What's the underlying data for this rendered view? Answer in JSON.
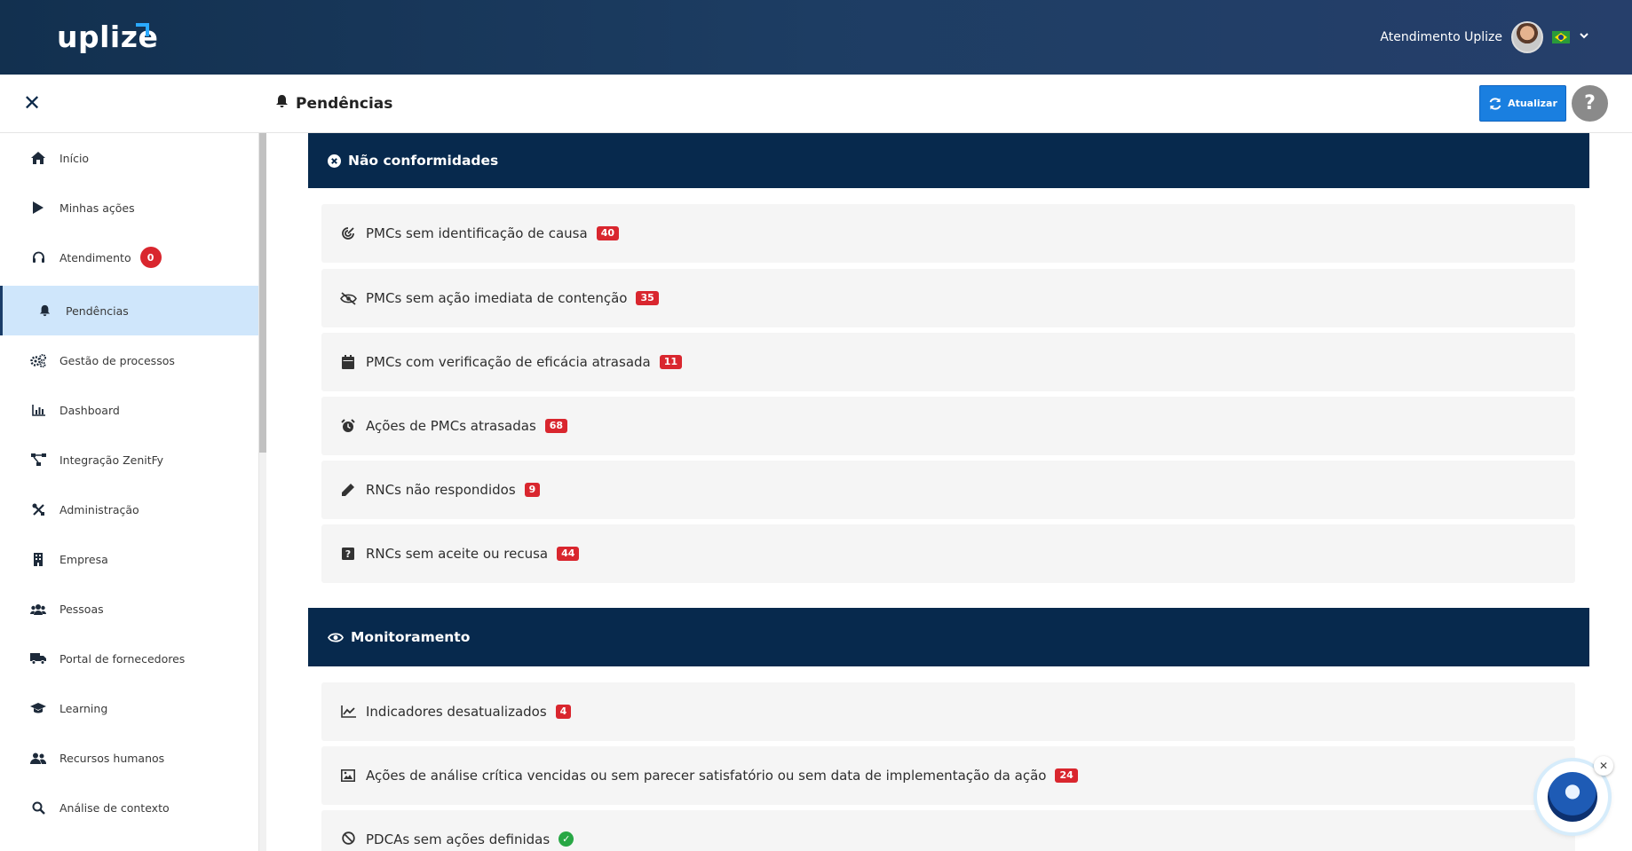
{
  "topbar": {
    "logo": "uplize",
    "user_name": "Atendimento Uplize"
  },
  "header": {
    "page_title": "Pendências",
    "refresh_label": "Atualizar",
    "help_label": "?"
  },
  "sidebar": {
    "items": [
      {
        "label": "Início",
        "icon": "home-icon"
      },
      {
        "label": "Minhas ações",
        "icon": "play-icon"
      },
      {
        "label": "Atendimento",
        "icon": "headset-icon",
        "badge": "0"
      },
      {
        "label": "Pendências",
        "icon": "bell-icon",
        "active": true
      },
      {
        "label": "Gestão de processos",
        "icon": "cogs-icon"
      },
      {
        "label": "Dashboard",
        "icon": "bar-chart-icon"
      },
      {
        "label": "Integração ZenitFy",
        "icon": "network-icon"
      },
      {
        "label": "Administração",
        "icon": "tools-icon"
      },
      {
        "label": "Empresa",
        "icon": "building-icon"
      },
      {
        "label": "Pessoas",
        "icon": "users-icon"
      },
      {
        "label": "Portal de fornecedores",
        "icon": "truck-icon"
      },
      {
        "label": "Learning",
        "icon": "graduation-cap-icon"
      },
      {
        "label": "Recursos humanos",
        "icon": "user-group-icon"
      },
      {
        "label": "Análise de contexto",
        "icon": "search-icon"
      }
    ]
  },
  "sections": {
    "nao_conformidades": {
      "title": "Não conformidades",
      "items": [
        {
          "label": "PMCs sem identificação de causa",
          "count": "40",
          "icon": "target-icon"
        },
        {
          "label": "PMCs sem ação imediata de contenção",
          "count": "35",
          "icon": "eye-slash-icon"
        },
        {
          "label": "PMCs com verificação de eficácia atrasada",
          "count": "11",
          "icon": "calendar-icon"
        },
        {
          "label": "Ações de  PMCs atrasadas",
          "count": "68",
          "icon": "alarm-clock-icon"
        },
        {
          "label": "RNCs não respondidos",
          "count": "9",
          "icon": "pencil-icon"
        },
        {
          "label": "RNCs sem aceite ou recusa",
          "count": "44",
          "icon": "question-square-icon"
        }
      ]
    },
    "monitoramento": {
      "title": "Monitoramento",
      "items": [
        {
          "label": "Indicadores desatualizados",
          "count": "4",
          "icon": "line-chart-icon"
        },
        {
          "label": "Ações de análise crítica vencidas ou sem parecer satisfatório ou sem data de implementação da ação",
          "count": "24",
          "icon": "image-icon"
        },
        {
          "label": "PDCAs sem ações definidas",
          "icon": "ban-icon",
          "status": "ok"
        }
      ]
    }
  },
  "colors": {
    "topbar": "#12304f",
    "section_header": "#07294d",
    "badge_red": "#d9262e",
    "button_blue": "#1a7fe0",
    "active_nav": "#cfe6fb",
    "ok_green": "#28a745"
  }
}
